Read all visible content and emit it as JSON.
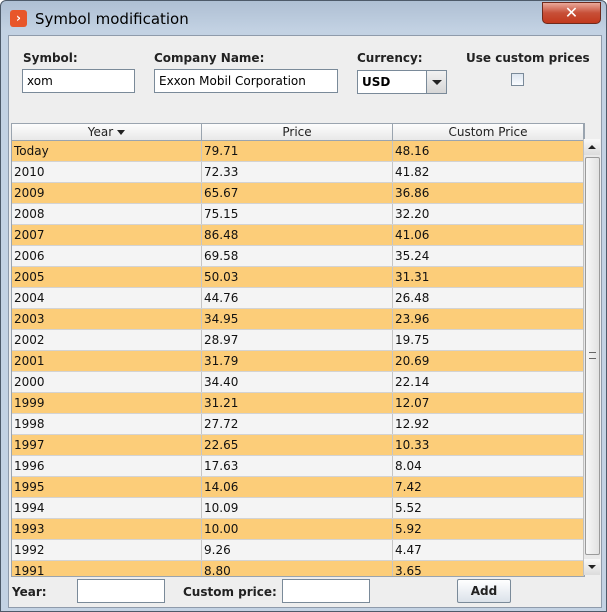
{
  "window": {
    "title": "Symbol modification",
    "close_glyph": "✕",
    "app_icon_glyph": "›"
  },
  "form": {
    "symbol_label": "Symbol:",
    "symbol_value": "xom",
    "company_label": "Company Name:",
    "company_value": "Exxon Mobil Corporation",
    "currency_label": "Currency:",
    "currency_value": "USD",
    "custom_prices_label": "Use custom prices",
    "custom_prices_checked": false
  },
  "table": {
    "columns": [
      "Year",
      "Price",
      "Custom Price"
    ],
    "sorted_column": "Year",
    "rows": [
      [
        "Today",
        "79.71",
        "48.16"
      ],
      [
        "2010",
        "72.33",
        "41.82"
      ],
      [
        "2009",
        "65.67",
        "36.86"
      ],
      [
        "2008",
        "75.15",
        "32.20"
      ],
      [
        "2007",
        "86.48",
        "41.06"
      ],
      [
        "2006",
        "69.58",
        "35.24"
      ],
      [
        "2005",
        "50.03",
        "31.31"
      ],
      [
        "2004",
        "44.76",
        "26.48"
      ],
      [
        "2003",
        "34.95",
        "23.96"
      ],
      [
        "2002",
        "28.97",
        "19.75"
      ],
      [
        "2001",
        "31.79",
        "20.69"
      ],
      [
        "2000",
        "34.40",
        "22.14"
      ],
      [
        "1999",
        "31.21",
        "12.07"
      ],
      [
        "1998",
        "27.72",
        "12.92"
      ],
      [
        "1997",
        "22.65",
        "10.33"
      ],
      [
        "1996",
        "17.63",
        "8.04"
      ],
      [
        "1995",
        "14.06",
        "7.42"
      ],
      [
        "1994",
        "10.09",
        "5.52"
      ],
      [
        "1993",
        "10.00",
        "5.92"
      ],
      [
        "1992",
        "9.26",
        "4.47"
      ],
      [
        "1991",
        "8.80",
        "3.65"
      ]
    ]
  },
  "footer": {
    "year_label": "Year:",
    "year_value": "",
    "custom_price_label": "Custom price:",
    "custom_price_value": "",
    "add_label": "Add"
  },
  "colors": {
    "row_highlight": "#fccd79",
    "row_plain": "#f4f4f4",
    "close_button": "#c74f37"
  }
}
